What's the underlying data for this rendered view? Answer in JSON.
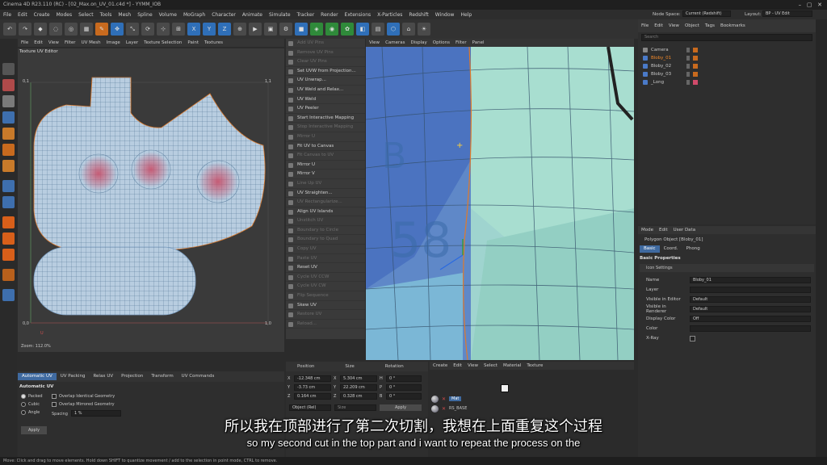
{
  "window_title": "Cinema 4D R23.110 (RC) - [02_Max.on_UV_01.c4d *] - YYMM_IOB",
  "menu": [
    "File",
    "Edit",
    "Create",
    "Modes",
    "Select",
    "Tools",
    "Mesh",
    "Spline",
    "Volume",
    "MoGraph",
    "Character",
    "Animate",
    "Simulate",
    "Tracker",
    "Render",
    "Extensions",
    "X-Particles",
    "Redshift",
    "Window",
    "Help"
  ],
  "node_space_label": "Node Space:",
  "node_space_value": "Current (Redshift)",
  "layout_label": "Layout:",
  "layout_value": "BP - UV Edit",
  "uv_editor": {
    "menu": [
      "File",
      "Edit",
      "View",
      "Filter",
      "UV Mesh",
      "Image",
      "Layer",
      "Texture Selection",
      "Paint",
      "Textures"
    ],
    "title": "Texture UV Editor",
    "tick_tl": "0,1",
    "tick_tr": "1,1",
    "tick_bl": "0,0",
    "tick_br": "1,0",
    "axis_u": "U",
    "zoom": "Zoom: 112.0%"
  },
  "commands": [
    {
      "label": "Add UV Pins",
      "dim": true
    },
    {
      "label": "Remove UV Pins",
      "dim": true
    },
    {
      "label": "Clear UV Pins",
      "dim": true
    },
    {
      "label": "Set UVW from Projection...",
      "dim": false
    },
    {
      "label": "UV Unwrap...",
      "dim": false
    },
    {
      "label": "UV Weld and Relax...",
      "dim": false
    },
    {
      "label": "UV Weld",
      "dim": false
    },
    {
      "label": "UV Peeler",
      "dim": false
    },
    {
      "label": "Start Interactive Mapping",
      "dim": false
    },
    {
      "label": "Stop Interactive Mapping",
      "dim": true
    },
    {
      "label": "Mirror U",
      "dim": true
    },
    {
      "label": "Fit UV to Canvas",
      "dim": false
    },
    {
      "label": "Fit Canvas to UV",
      "dim": true
    },
    {
      "label": "Mirror U",
      "dim": false
    },
    {
      "label": "Mirror V",
      "dim": false
    },
    {
      "label": "Line Up UV",
      "dim": true
    },
    {
      "label": "UV Straighten...",
      "dim": false
    },
    {
      "label": "UV Rectangularize...",
      "dim": true
    },
    {
      "label": "Align UV Islands",
      "dim": false
    },
    {
      "label": "Unstitch UV",
      "dim": true
    },
    {
      "label": "Boundary to Circle",
      "dim": true
    },
    {
      "label": "Boundary to Quad",
      "dim": true
    },
    {
      "label": "Copy UV",
      "dim": true
    },
    {
      "label": "Paste UV",
      "dim": true
    },
    {
      "label": "Reset UV",
      "dim": false
    },
    {
      "label": "Cycle UV CCW",
      "dim": true
    },
    {
      "label": "Cycle UV CW",
      "dim": true
    },
    {
      "label": "Flip Sequence",
      "dim": true
    },
    {
      "label": "Skew UV",
      "dim": false
    },
    {
      "label": "Restore UV",
      "dim": true
    },
    {
      "label": "Reload...",
      "dim": true
    }
  ],
  "viewport": {
    "menu": [
      "View",
      "Cameras",
      "Display",
      "Options",
      "Filter",
      "Panel"
    ]
  },
  "object_manager": {
    "menu": [
      "File",
      "Edit",
      "View",
      "Object",
      "Tags",
      "Bookmarks"
    ],
    "search_placeholder": "Search",
    "objects": [
      "Camera",
      "Bloby_01",
      "Bloby_02",
      "Bloby_03",
      "_Long"
    ]
  },
  "attributes": {
    "menu": [
      "Mode",
      "Edit",
      "User Data"
    ],
    "object_title": "Polygon Object [Bloby_01]",
    "tabs": [
      "Basic",
      "Coord.",
      "Phong"
    ],
    "section": "Basic Properties",
    "icon_settings": "Icon Settings",
    "fields": [
      {
        "label": "Name",
        "value": "Bloby_01"
      },
      {
        "label": "Layer",
        "value": ""
      },
      {
        "label": "Visible in Editor",
        "value": "Default"
      },
      {
        "label": "Visible in Renderer",
        "value": "Default"
      },
      {
        "label": "Display Color",
        "value": "Off"
      },
      {
        "label": "Color",
        "value": ""
      },
      {
        "label": "X-Ray",
        "value": ""
      }
    ]
  },
  "uv_tools": {
    "tabs": [
      "Automatic UV",
      "UV Packing",
      "Relax UV",
      "Projection",
      "Transform",
      "UV Commands"
    ],
    "section": "Automatic UV",
    "radios": [
      "Packed",
      "Cubic",
      "Angle"
    ],
    "checks": [
      "Overlap Identical Geometry",
      "Overlap Mirrored Geometry"
    ],
    "spacing_label": "Spacing",
    "spacing_value": "1 %",
    "apply": "Apply"
  },
  "coords": {
    "headers": [
      "Position",
      "Size",
      "Rotation"
    ],
    "rows": [
      {
        "axis": "X",
        "pos": "-12.348 cm",
        "size_axis": "X",
        "size": "5.304 cm",
        "rot_axis": "H",
        "rot": "0 °"
      },
      {
        "axis": "Y",
        "pos": "-3.73 cm",
        "size_axis": "Y",
        "size": "22.209 cm",
        "rot_axis": "P",
        "rot": "0 °"
      },
      {
        "axis": "Z",
        "pos": "0.164 cm",
        "size_axis": "Z",
        "size": "0.328 cm",
        "rot_axis": "B",
        "rot": "0 °"
      }
    ],
    "mode": "Object (Rel)",
    "size_mode": "Size",
    "apply": "Apply"
  },
  "material": {
    "menu": [
      "Create",
      "Edit",
      "View",
      "Select",
      "Material",
      "Texture"
    ],
    "items": [
      "Mat",
      "RS_BASE"
    ]
  },
  "subtitle_cn": "所以我在顶部进行了第二次切割，我想在上面重复这个过程",
  "subtitle_en": "so my second cut in the top part and i want to repeat the process on the",
  "status": "Move: Click and drag to move elements. Hold down SHIFT to quantize movement / add to the selection in point mode, CTRL to remove."
}
